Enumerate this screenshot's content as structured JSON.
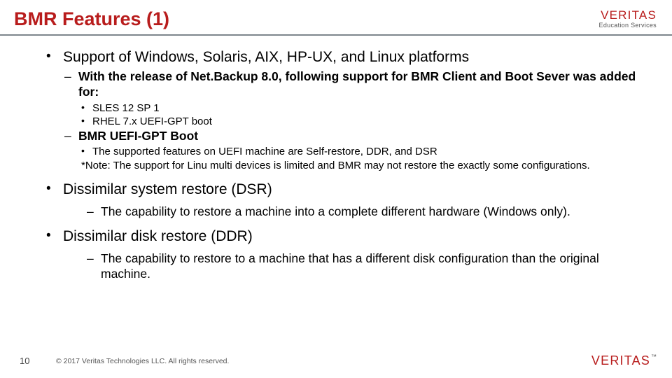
{
  "header": {
    "title": "BMR Features (1)",
    "brand": "VERITAS",
    "brand_sub": "Education Services"
  },
  "content": {
    "b1": {
      "text": "Support of Windows, Solaris, AIX, HP-UX, and Linux platforms",
      "sub1": {
        "text": "With the release of Net.Backup 8.0, following support for BMR Client and Boot Sever was added for:",
        "items": [
          "SLES 12 SP 1",
          "RHEL 7.x UEFI-GPT boot"
        ]
      },
      "sub2": {
        "text": "BMR UEFI-GPT Boot",
        "items": [
          "The supported features on UEFI machine are Self-restore, DDR, and DSR"
        ],
        "note": "*Note: The support for Linu multi devices is limited and BMR may not restore the exactly some configurations."
      }
    },
    "b2": {
      "text": "Dissimilar system restore (DSR)",
      "sub": "The capability to restore a machine into a complete different hardware (Windows only)."
    },
    "b3": {
      "text": "Dissimilar disk restore (DDR)",
      "sub": "The capability to restore to a machine that has a different disk configuration than the original machine."
    }
  },
  "footer": {
    "page": "10",
    "copyright": "© 2017 Veritas Technologies LLC. All rights reserved.",
    "brand": "VERITAS"
  }
}
